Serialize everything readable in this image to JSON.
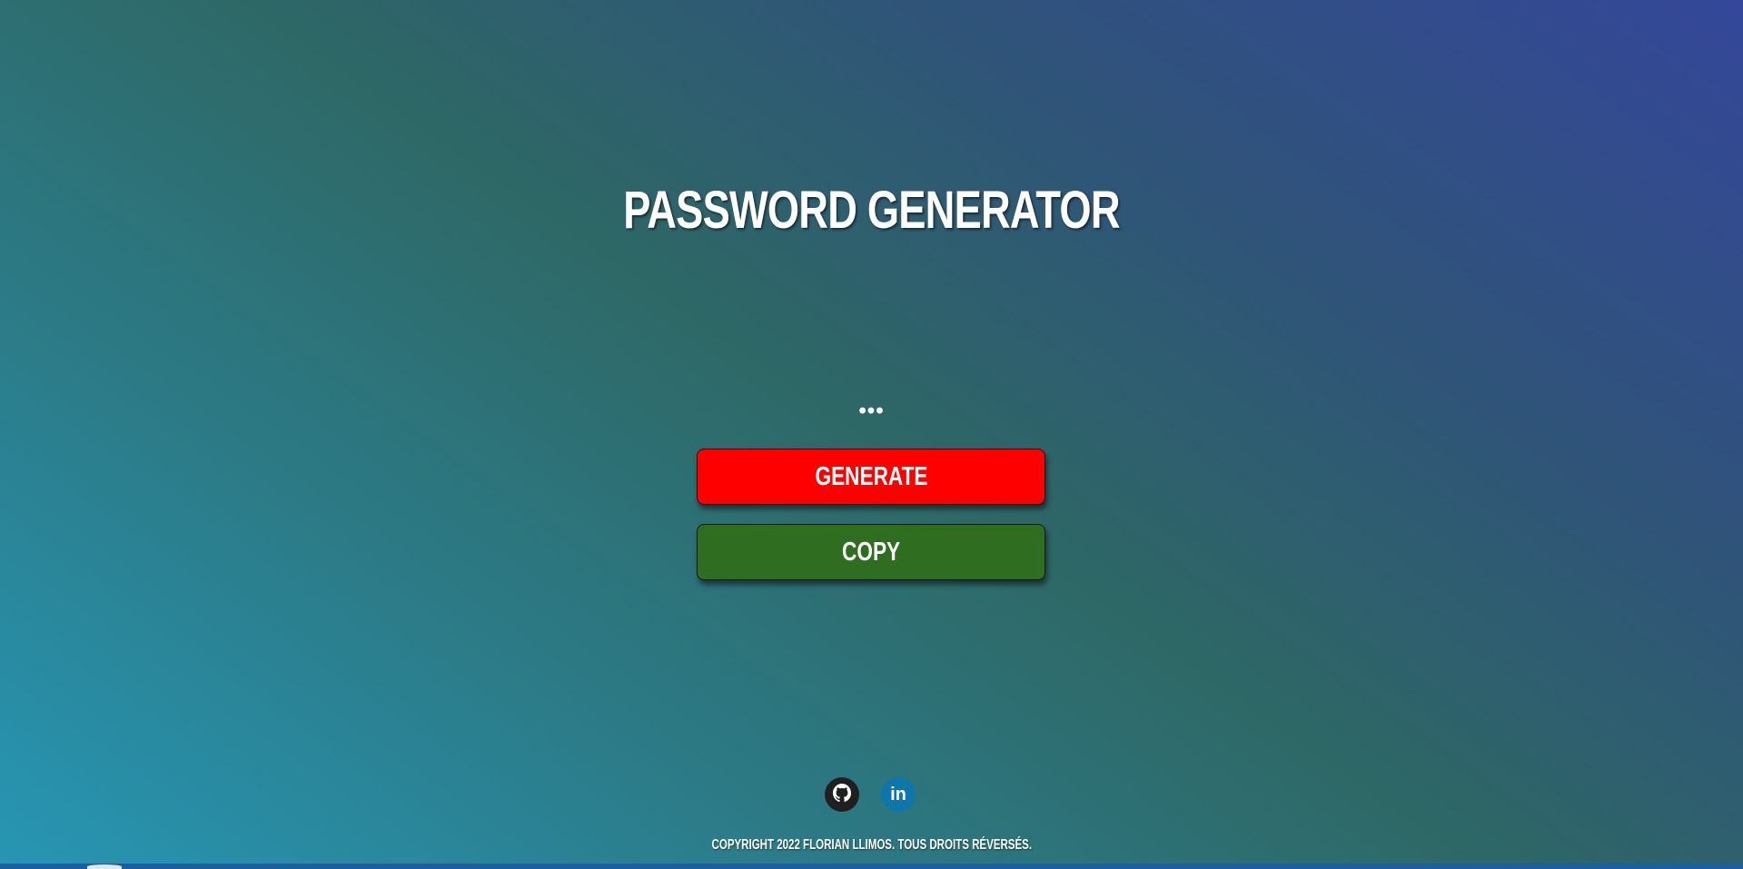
{
  "header": {
    "title": "PASSWORD GENERATOR"
  },
  "main": {
    "password_display": "•••",
    "generate_label": "GENERATE",
    "copy_label": "COPY"
  },
  "footer": {
    "socials": [
      {
        "name": "github",
        "icon": "github-icon"
      },
      {
        "name": "linkedin",
        "icon": "linkedin-icon",
        "glyph": "in"
      }
    ],
    "copyright": "COPYRIGHT 2022 FLORIAN LLIMOS. TOUS DROITS RÉVERSÉS."
  },
  "colors": {
    "generate_button": "#ff0000",
    "copy_button": "#2f6e21",
    "github_badge": "#1f1f1f",
    "linkedin_badge": "#0e76a8",
    "gradient_bottom_left": "#2796b4",
    "gradient_middle": "#2e6866",
    "gradient_top_right": "#34479a"
  }
}
